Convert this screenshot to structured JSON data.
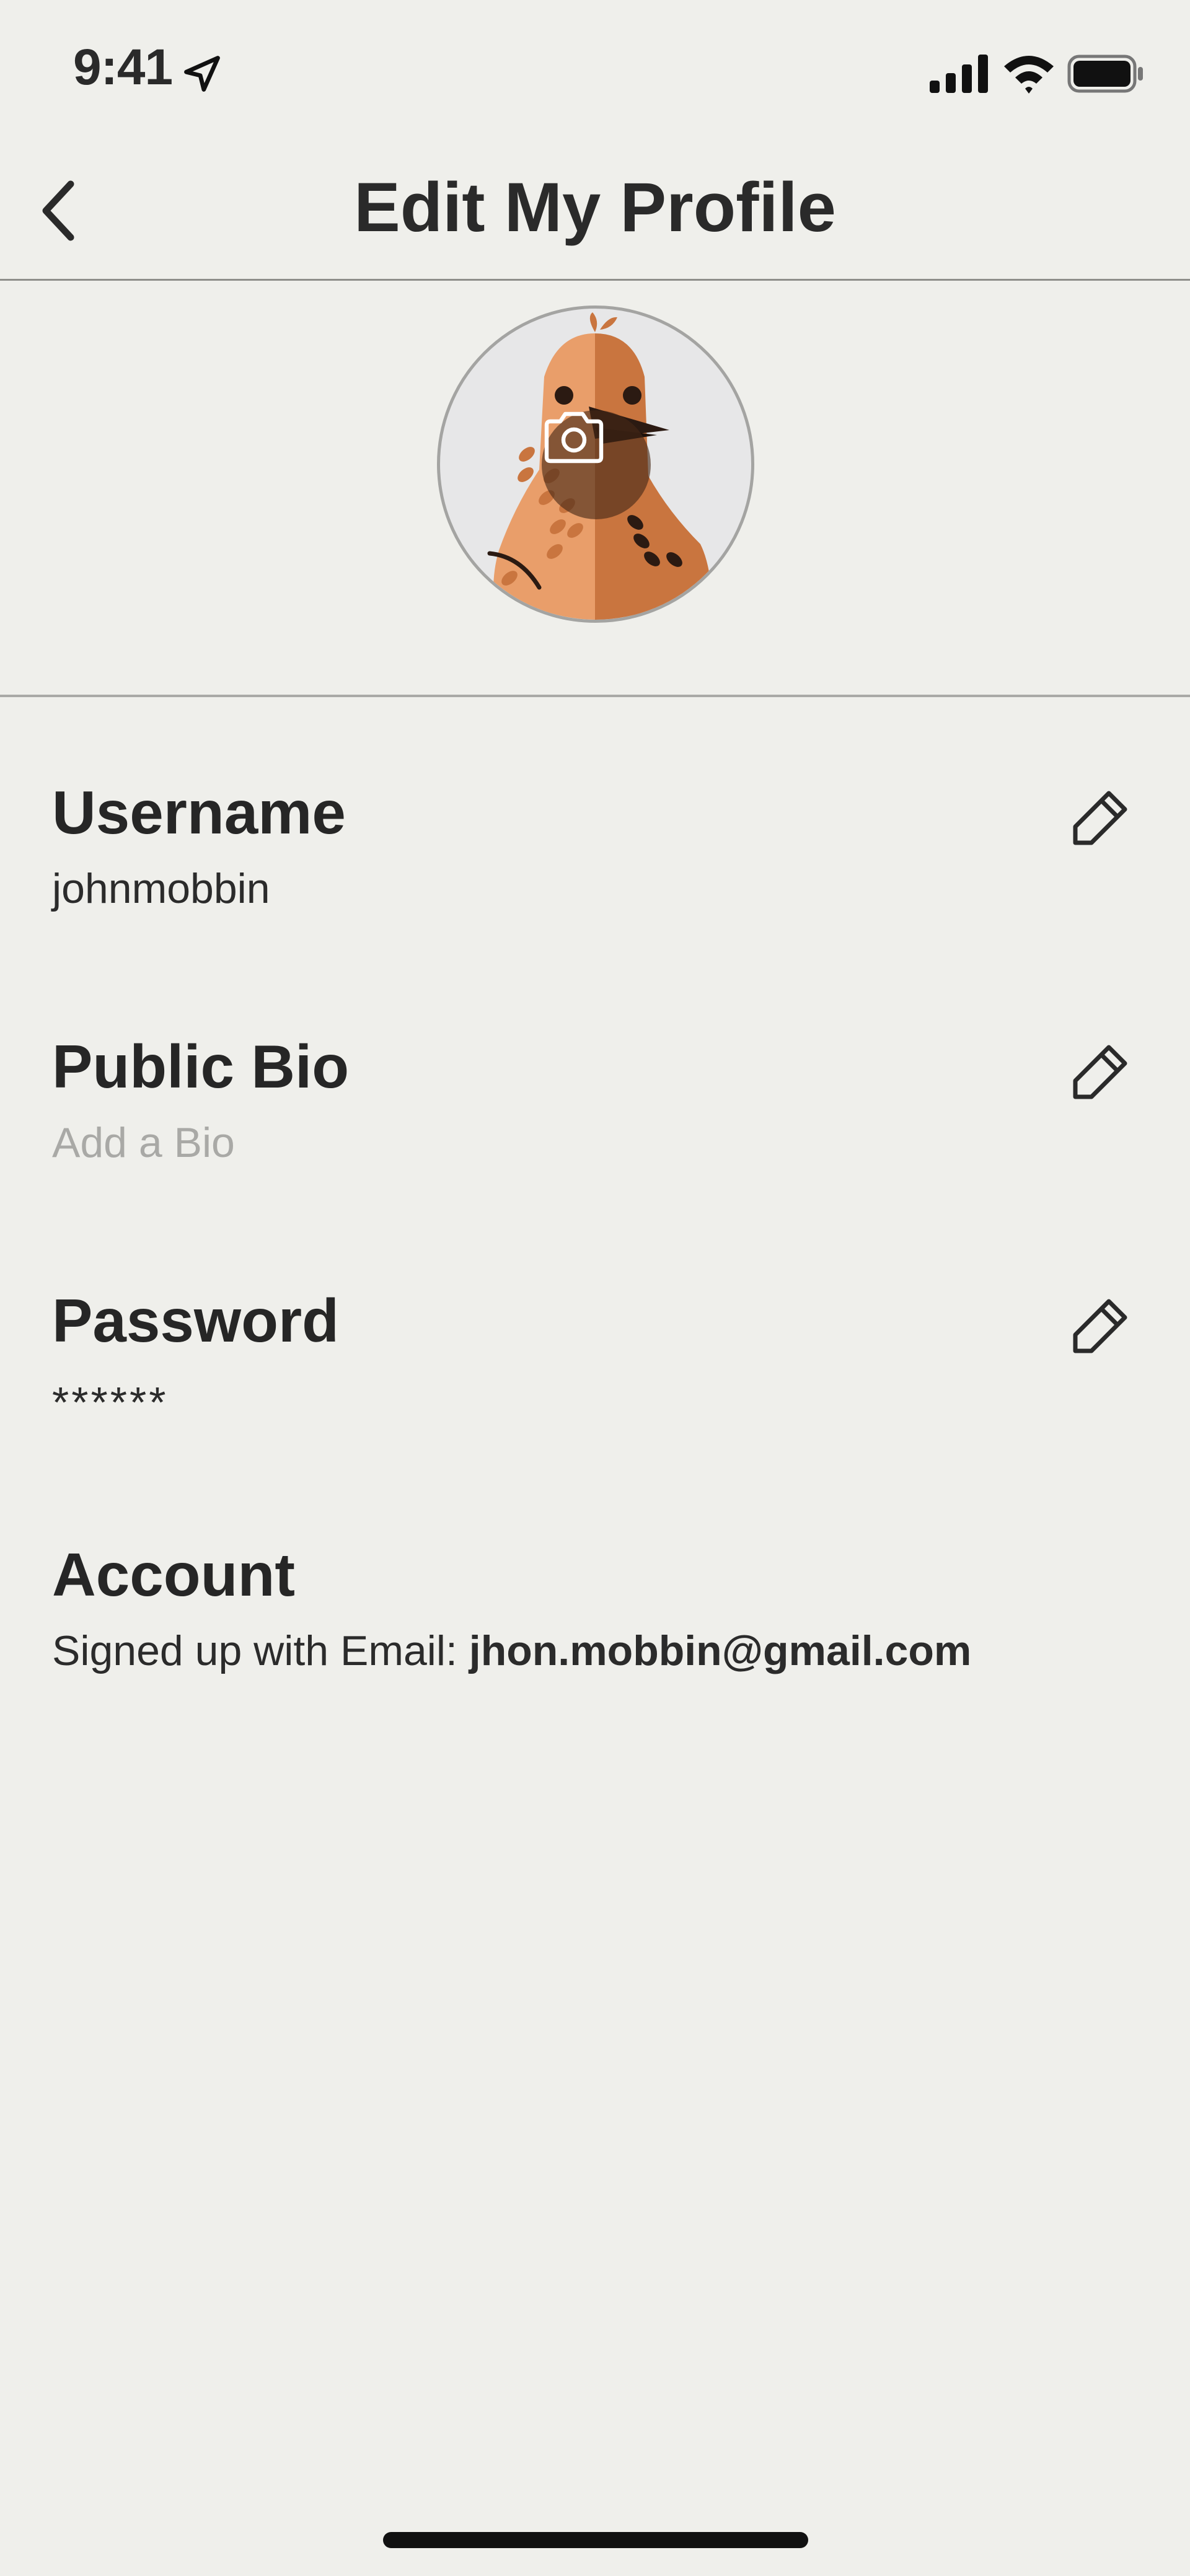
{
  "status_bar": {
    "time": "9:41",
    "icons": [
      "location-arrow-icon",
      "cellular-signal-icon",
      "wifi-icon",
      "battery-icon"
    ]
  },
  "header": {
    "title": "Edit My Profile",
    "back_icon": "chevron-left-icon"
  },
  "avatar": {
    "camera_icon": "camera-icon",
    "colors": {
      "background": "#e7e7e8",
      "bird_light": "#e99e6a",
      "bird_dark": "#c9753f",
      "beak": "#2b1a12"
    }
  },
  "fields": [
    {
      "label": "Username",
      "value": "johnmobbin",
      "edit_icon": "pencil-icon"
    },
    {
      "label": "Public Bio",
      "placeholder": "Add a Bio",
      "edit_icon": "pencil-icon"
    },
    {
      "label": "Password",
      "value": "******",
      "edit_icon": "pencil-icon"
    }
  ],
  "account": {
    "label": "Account",
    "prefix": "Signed up with Email: ",
    "email": "jhon.mobbin@gmail.com"
  },
  "colors": {
    "background": "#efefeb",
    "text": "#262626",
    "placeholder": "#a9a9a6",
    "divider": "#8e8e8a"
  }
}
